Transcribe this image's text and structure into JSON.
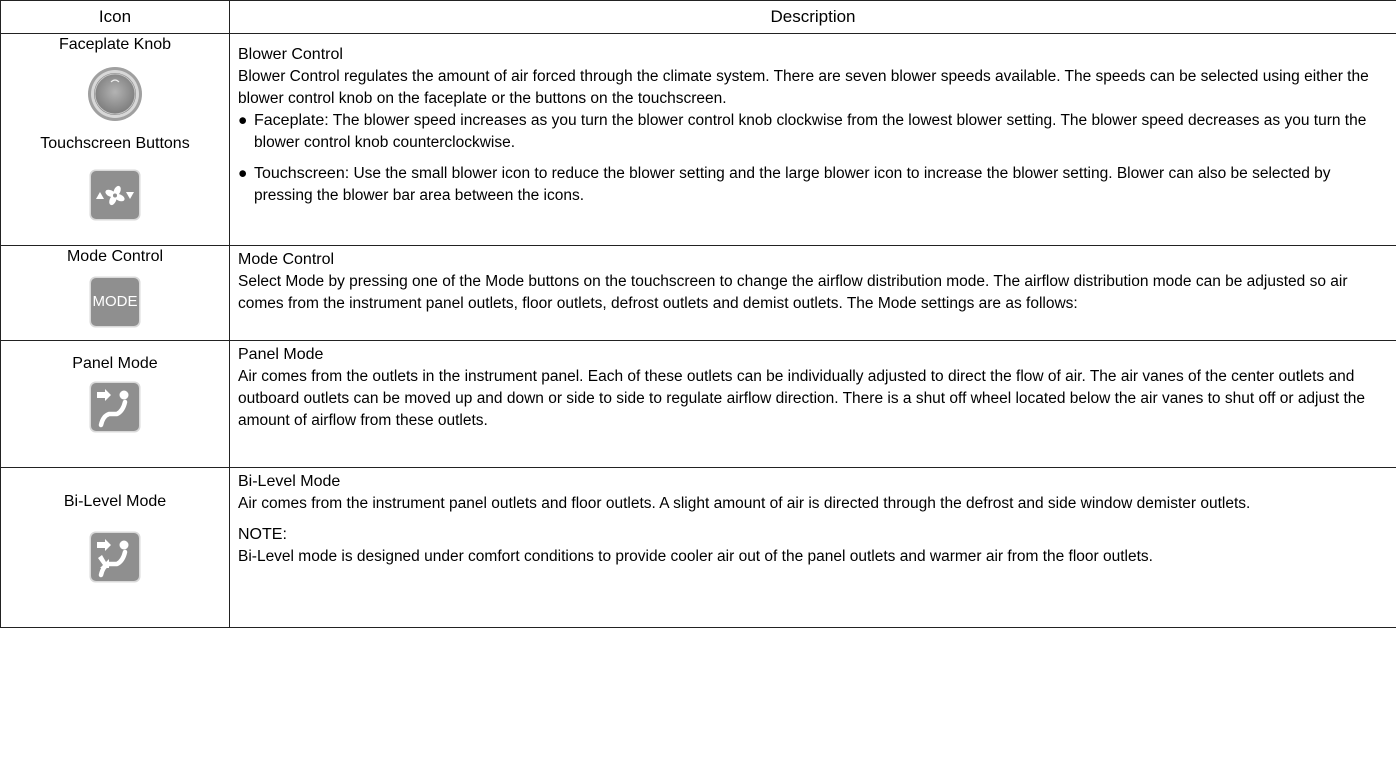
{
  "header": {
    "icon": "Icon",
    "description": "Description"
  },
  "rows": [
    {
      "icon_labels": [
        "Faceplate Knob",
        "Touchscreen Buttons"
      ],
      "icons": [
        "knob-icon",
        "blower-buttons-icon"
      ],
      "title": "Blower Control",
      "paragraphs": [
        "Blower Control regulates the amount of air forced through the climate system. There are seven blower speeds available. The speeds can be selected using either the blower control knob on the faceplate or the buttons on the touchscreen."
      ],
      "bullets": [
        {
          "term": "Faceplate:",
          "text": " The blower speed increases as you turn the blower control knob clockwise from the lowest blower setting. The blower speed decreases as you turn the blower control knob counterclockwise."
        },
        {
          "term": "Touchscreen:",
          "text": " Use the small blower icon to reduce the blower setting and the large blower icon to increase the blower setting. Blower can also be selected by pressing the blower bar area between the icons."
        }
      ]
    },
    {
      "icon_labels": [
        "Mode Control"
      ],
      "icons": [
        "mode-button-icon"
      ],
      "icon_text": "MODE",
      "title": "Mode Control",
      "paragraphs": [
        "Select Mode by pressing one of the Mode buttons on the touchscreen to change the airflow distribution mode. The airflow distribution mode can be adjusted so air comes from the instrument panel outlets, floor outlets, defrost outlets and demist outlets. The Mode settings are as follows:"
      ]
    },
    {
      "icon_labels": [
        "Panel Mode"
      ],
      "icons": [
        "panel-mode-icon"
      ],
      "title": "Panel Mode",
      "paragraphs": [
        "Air comes from the outlets in the instrument panel. Each of these outlets can be individually adjusted to direct the flow of air. The air vanes of the center outlets and outboard outlets can be moved up and down or side to side to regulate airflow direction. There is a shut off wheel located below the air vanes to shut off or adjust the amount of airflow from these outlets."
      ]
    },
    {
      "icon_labels": [
        "Bi-Level Mode"
      ],
      "icons": [
        "bi-level-mode-icon"
      ],
      "title": "Bi-Level Mode",
      "paragraphs": [
        "Air comes from the instrument panel outlets and floor outlets. A slight amount of air is directed through the defrost and side window demister outlets."
      ],
      "note_label": "NOTE:",
      "note": "Bi-Level mode is designed under comfort conditions to provide cooler air out of the panel outlets and warmer air from the floor outlets."
    }
  ],
  "colors": {
    "tile": "#8f8f8f",
    "tile_edge": "#d9d9d9",
    "border": "#222222"
  }
}
